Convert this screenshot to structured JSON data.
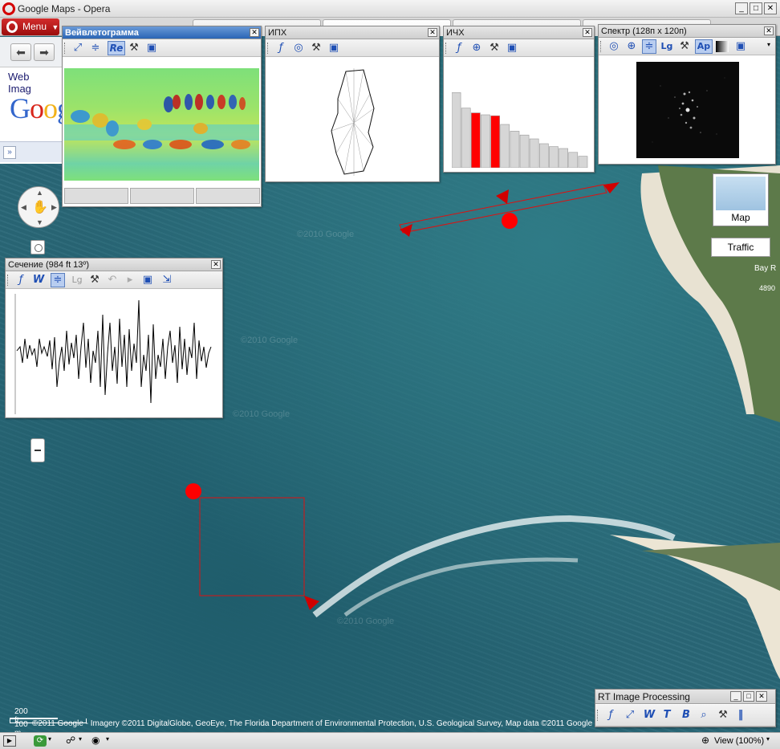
{
  "browser": {
    "title": "Google Maps - Opera",
    "menu_label": "Menu",
    "window_buttons": [
      "_",
      "□",
      "✕"
    ]
  },
  "google": {
    "links": [
      "Web",
      "Imag"
    ],
    "logo_letters": [
      "G",
      "o",
      "o",
      "g"
    ],
    "logo_colors": [
      "#3366cc",
      "#d8261b",
      "#f2b21a",
      "#3366cc"
    ],
    "expand_label": "»"
  },
  "map": {
    "map_type_label": "Map",
    "traffic_label": "Traffic",
    "scale_ft": "200 ft",
    "scale_m": "100 m",
    "attribution": "©2011 Google - Imagery ©2011 DigitalGlobe, GeoEye, The Florida Department of Environmental Protection, U.S. Geological Survey, Map data ©2011 Google",
    "road_label": "Bay R",
    "road_number": "4890",
    "watermark": "©2010 Google"
  },
  "windows": {
    "wavelet": {
      "title": "Вейвлетограмма",
      "close": "✕",
      "toolbar_icons": [
        "fit-icon",
        "align-icon",
        "re-icon",
        "settings-icon",
        "save-icon"
      ],
      "re_label": "Re"
    },
    "ipkh": {
      "title": "ИПХ",
      "close": "✕",
      "toolbar_icons": [
        "function-icon",
        "target-icon",
        "settings-icon",
        "save-icon"
      ]
    },
    "ichkh": {
      "title": "ИЧХ",
      "close": "✕",
      "toolbar_icons": [
        "function-icon",
        "crosshair-icon",
        "settings-icon",
        "save-icon"
      ],
      "bars": [
        0.78,
        0.62,
        0.57,
        0.55,
        0.54,
        0.45,
        0.38,
        0.34,
        0.3,
        0.25,
        0.22,
        0.2,
        0.16,
        0.12
      ],
      "highlighted": [
        2,
        4
      ]
    },
    "spectrum": {
      "title": "Спектр (128п x 120п)",
      "close": "✕",
      "ap_label": "Ap",
      "lg_label": "Lg",
      "toolbar_icons": [
        "target-icon",
        "crosshair-icon",
        "align-icon",
        "lg-icon",
        "settings-icon",
        "ap-icon",
        "gradient-icon",
        "save-icon"
      ]
    },
    "section": {
      "title": "Сечение (984 ft 13º)",
      "close": "✕",
      "lg_label": "Lg",
      "toolbar_icons": [
        "function-icon",
        "w-icon",
        "align-icon",
        "lg-icon",
        "settings-icon",
        "undo-icon",
        "cursor-icon",
        "save-icon",
        "export-icon"
      ]
    },
    "rt": {
      "title": "RT Image Processing",
      "toolbar_icons": [
        "function-icon",
        "fit-icon",
        "w-icon",
        "text-icon",
        "b-icon",
        "search-icon",
        "settings-icon",
        "pause-icon"
      ]
    }
  },
  "statusbar": {
    "zoom_label": "View (100%)"
  }
}
